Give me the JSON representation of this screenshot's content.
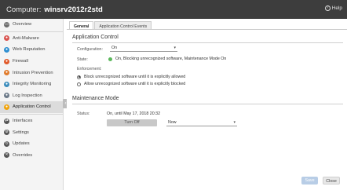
{
  "titlebar": {
    "label": "Computer:",
    "computer_name": "winsrv2012r2std",
    "help_label": "Help"
  },
  "sidebar": {
    "items": [
      {
        "label": "Overview",
        "icon": "monitor-icon",
        "color": "#6d6d6d"
      },
      {
        "label": "Anti-Malware",
        "icon": "shield-icon",
        "color": "#d9534f"
      },
      {
        "label": "Web Reputation",
        "icon": "globe-icon",
        "color": "#2f8fd0"
      },
      {
        "label": "Firewall",
        "icon": "firewall-icon",
        "color": "#e05a2b"
      },
      {
        "label": "Intrusion Prevention",
        "icon": "intrusion-icon",
        "color": "#e07b2b"
      },
      {
        "label": "Integrity Monitoring",
        "icon": "integrity-icon",
        "color": "#3c8dbc"
      },
      {
        "label": "Log Inspection",
        "icon": "log-icon",
        "color": "#6c7a89"
      },
      {
        "label": "Application Control",
        "icon": "app-control-icon",
        "color": "#f0a30a"
      },
      {
        "label": "Interfaces",
        "icon": "interfaces-icon",
        "color": "#555555"
      },
      {
        "label": "Settings",
        "icon": "gear-icon",
        "color": "#555555"
      },
      {
        "label": "Updates",
        "icon": "updates-icon",
        "color": "#555555"
      },
      {
        "label": "Overrides",
        "icon": "overrides-icon",
        "color": "#555555"
      }
    ],
    "active_index": 7
  },
  "tabs": [
    {
      "label": "General"
    },
    {
      "label": "Application Control Events"
    }
  ],
  "active_tab": 0,
  "app_control": {
    "title": "Application Control",
    "configuration_label": "Configuration:",
    "configuration_value": "On",
    "state_label": "State:",
    "state_text": "On, Blocking unrecognized software, Maintenance Mode On",
    "state_color": "#5cb85c",
    "enforcement_label": "Enforcement:",
    "enforcement_options": [
      "Block unrecognized software until it is explicitly allowed",
      "Allow unrecognized software until it is explicitly blocked"
    ],
    "enforcement_selected": 0
  },
  "maintenance": {
    "title": "Maintenance Mode",
    "status_label": "Status:",
    "status_text": "On, until May 17, 2018 20:32",
    "turn_off_label": "Turn Off",
    "duration_value": "Now"
  },
  "footer": {
    "save_label": "Save",
    "close_label": "Close"
  }
}
